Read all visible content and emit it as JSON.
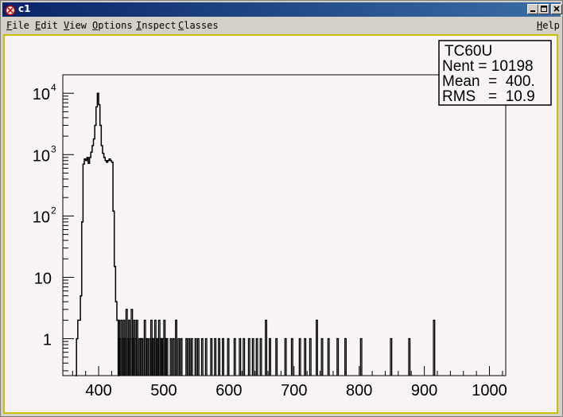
{
  "window": {
    "title": "c1",
    "controls": [
      "minimize-icon",
      "maximize-icon",
      "close-icon"
    ]
  },
  "menubar": {
    "items": [
      "File",
      "Edit",
      "View",
      "Options",
      "Inspect",
      "Classes"
    ],
    "help": "Help"
  },
  "stats_box": {
    "name": "TC60U",
    "entries_line": "Nent = 10198",
    "mean_line": "Mean  =  400.",
    "rms_line": "RMS   =  10.9"
  },
  "chart_data": {
    "type": "histogram",
    "title": "",
    "xlabel": "",
    "ylabel": "",
    "xlim": [
      345,
      1025
    ],
    "ylim": [
      0.25,
      20000
    ],
    "yscale": "log",
    "xticks": [
      "400",
      "500",
      "600",
      "700",
      "800",
      "900",
      "1000"
    ],
    "ytick_labels": [
      {
        "value": 1,
        "label": "1"
      },
      {
        "value": 10,
        "label": "10"
      },
      {
        "value": 100,
        "label": "10",
        "exp": "2"
      },
      {
        "value": 1000,
        "label": "10",
        "exp": "3"
      },
      {
        "value": 10000,
        "label": "10",
        "exp": "4"
      }
    ],
    "bin_width": 2,
    "envelope": [
      [
        364,
        0
      ],
      [
        366,
        1
      ],
      [
        368,
        2
      ],
      [
        370,
        2
      ],
      [
        372,
        5
      ],
      [
        374,
        80
      ],
      [
        376,
        700
      ],
      [
        378,
        850
      ],
      [
        380,
        800
      ],
      [
        382,
        900
      ],
      [
        384,
        720
      ],
      [
        386,
        900
      ],
      [
        388,
        1100
      ],
      [
        390,
        1400
      ],
      [
        392,
        1800
      ],
      [
        394,
        3000
      ],
      [
        396,
        6000
      ],
      [
        398,
        10000
      ],
      [
        400,
        6500
      ],
      [
        402,
        3000
      ],
      [
        404,
        1400
      ],
      [
        406,
        1050
      ],
      [
        408,
        900
      ],
      [
        410,
        800
      ],
      [
        412,
        750
      ],
      [
        414,
        800
      ],
      [
        416,
        850
      ],
      [
        418,
        800
      ],
      [
        420,
        750
      ],
      [
        422,
        120
      ],
      [
        424,
        15
      ],
      [
        426,
        4
      ],
      [
        428,
        2
      ],
      [
        430,
        0
      ]
    ],
    "sparse": [
      [
        430,
        2
      ],
      [
        432,
        1
      ],
      [
        434,
        2
      ],
      [
        436,
        1
      ],
      [
        438,
        2
      ],
      [
        440,
        1
      ],
      [
        442,
        3
      ],
      [
        444,
        1
      ],
      [
        446,
        2
      ],
      [
        448,
        1
      ],
      [
        450,
        3
      ],
      [
        452,
        1
      ],
      [
        454,
        2
      ],
      [
        456,
        1
      ],
      [
        458,
        2
      ],
      [
        462,
        1
      ],
      [
        464,
        1
      ],
      [
        466,
        1
      ],
      [
        470,
        2
      ],
      [
        472,
        1
      ],
      [
        474,
        1
      ],
      [
        478,
        1
      ],
      [
        480,
        2
      ],
      [
        482,
        1
      ],
      [
        484,
        1
      ],
      [
        486,
        2
      ],
      [
        488,
        1
      ],
      [
        490,
        1
      ],
      [
        492,
        2
      ],
      [
        494,
        1
      ],
      [
        496,
        1
      ],
      [
        498,
        1
      ],
      [
        500,
        2
      ],
      [
        502,
        1
      ],
      [
        504,
        1
      ],
      [
        510,
        1
      ],
      [
        514,
        1
      ],
      [
        518,
        2
      ],
      [
        522,
        1
      ],
      [
        526,
        1
      ],
      [
        534,
        1
      ],
      [
        538,
        1
      ],
      [
        542,
        1
      ],
      [
        548,
        1
      ],
      [
        552,
        1
      ],
      [
        558,
        1
      ],
      [
        564,
        1
      ],
      [
        572,
        1
      ],
      [
        578,
        1
      ],
      [
        584,
        1
      ],
      [
        590,
        1
      ],
      [
        598,
        1
      ],
      [
        608,
        1
      ],
      [
        616,
        1
      ],
      [
        622,
        1
      ],
      [
        630,
        1
      ],
      [
        636,
        1
      ],
      [
        642,
        1
      ],
      [
        648,
        1
      ],
      [
        656,
        2
      ],
      [
        662,
        1
      ],
      [
        672,
        1
      ],
      [
        686,
        1
      ],
      [
        696,
        1
      ],
      [
        708,
        1
      ],
      [
        716,
        1
      ],
      [
        724,
        1
      ],
      [
        734,
        2
      ],
      [
        742,
        1
      ],
      [
        752,
        1
      ],
      [
        766,
        1
      ],
      [
        778,
        1
      ],
      [
        802,
        1
      ],
      [
        848,
        1
      ],
      [
        876,
        1
      ],
      [
        914,
        2
      ]
    ]
  }
}
